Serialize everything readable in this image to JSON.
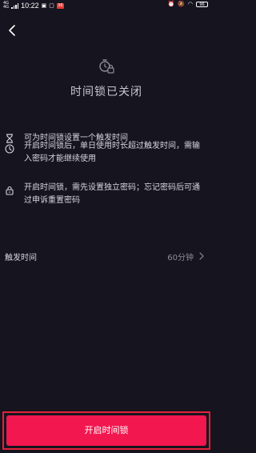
{
  "status_bar": {
    "network": "4G",
    "network2": "4G",
    "time": "10:22",
    "badge": "36",
    "battery": "96"
  },
  "page": {
    "title": "时间锁已关闭"
  },
  "info_items": [
    {
      "icon": "hourglass-icon",
      "text": "可为时间锁设置一个触发时间"
    },
    {
      "icon": "clock-icon",
      "text": "开启时间锁后，单日使用时长超过触发时间，需输入密码才能继续使用"
    },
    {
      "icon": "lock-icon",
      "text": "开启时间锁，需先设置独立密码；忘记密码后可通过申诉重置密码"
    }
  ],
  "trigger_setting": {
    "label": "触发时间",
    "value": "60分钟"
  },
  "cta": {
    "label": "开启时间锁"
  },
  "colors": {
    "background": "#16141f",
    "accent": "#f2174f",
    "highlight_outline": "#e2233a"
  }
}
